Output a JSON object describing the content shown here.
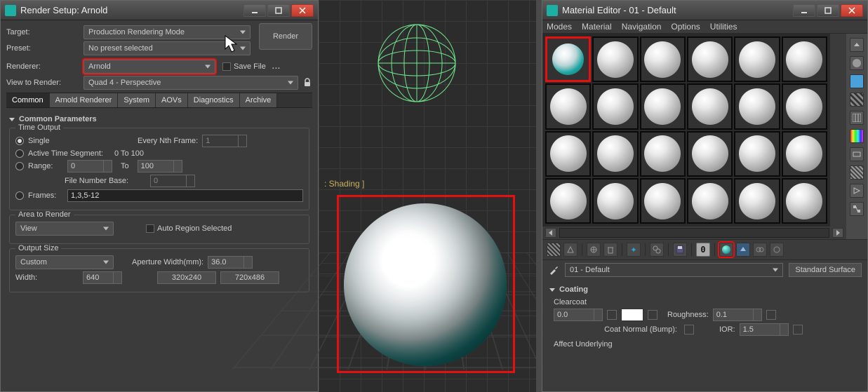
{
  "render": {
    "title": "Render Setup: Arnold",
    "target_label": "Target:",
    "target_value": "Production Rendering Mode",
    "render_button": "Render",
    "preset_label": "Preset:",
    "preset_value": "No preset selected",
    "renderer_label": "Renderer:",
    "renderer_value": "Arnold",
    "savefile_label": "Save File",
    "dots": "...",
    "view_label": "View to Render:",
    "view_value": "Quad 4 - Perspective",
    "tabs": [
      "Common",
      "Arnold Renderer",
      "System",
      "AOVs",
      "Diagnostics",
      "Archive"
    ],
    "panel_title": "Common Parameters",
    "time_group": "Time Output",
    "single": "Single",
    "every_nth": "Every Nth Frame:",
    "every_nth_val": "1",
    "active": "Active Time Segment:",
    "active_range": "0 To 100",
    "range": "Range:",
    "range_from": "0",
    "range_to_label": "To",
    "range_to": "100",
    "file_base": "File Number Base:",
    "file_base_val": "0",
    "frames": "Frames:",
    "frames_val": "1,3,5-12",
    "area_group": "Area to Render",
    "area_value": "View",
    "auto_region": "Auto Region Selected",
    "output_group": "Output Size",
    "output_value": "Custom",
    "aperture_label": "Aperture Width(mm):",
    "aperture_val": "36.0",
    "width_label": "Width:",
    "width_val": "640",
    "sz1": "320x240",
    "sz2": "720x486"
  },
  "viewport": {
    "label": ": Shading ]"
  },
  "material": {
    "title": "Material Editor - 01 - Default",
    "menu": [
      "Modes",
      "Material",
      "Navigation",
      "Options",
      "Utilities"
    ],
    "zero": "0",
    "name_value": "01 - Default",
    "type_btn": "Standard Surface",
    "section": "Coating",
    "sub_clear": "Clearcoat",
    "clear_val": "0.0",
    "rough_label": "Roughness:",
    "rough_val": "0.1",
    "coat_normal": "Coat Normal (Bump):",
    "ior_label": "IOR:",
    "ior_val": "1.5",
    "affect": "Affect Underlying"
  }
}
